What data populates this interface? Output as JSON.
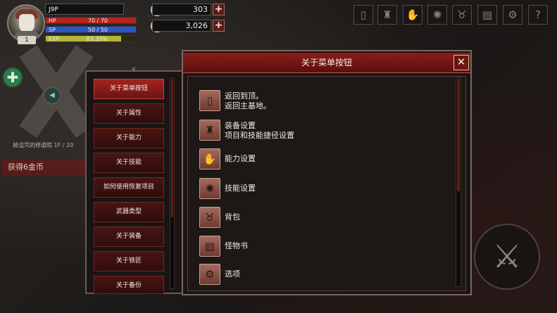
{
  "player": {
    "name": "J9P",
    "level": "1",
    "hp_label": "HP",
    "hp_value": "70 / 70",
    "hp_fraction": 1.0,
    "sp_label": "SP",
    "sp_value": "50 / 50",
    "sp_fraction": 1.0,
    "exp_label": "EXP",
    "exp_value": "83.33%",
    "exp_fraction": 0.8333
  },
  "currency": {
    "gems": "303",
    "gold": "3,026",
    "plus": "+"
  },
  "toolbar": {
    "icons": [
      "door-icon",
      "armor-icon",
      "ability-icon",
      "skill-icon",
      "bag-icon",
      "book-icon",
      "gear-icon",
      "help-icon"
    ],
    "help_glyph": "?",
    "gear_glyph": "⚙"
  },
  "hud": {
    "add_glyph": "✚",
    "nav_glyph": "◀",
    "location": "被诅咒的修道院 1F / 20",
    "toast": "获得6金币",
    "sword_glyph": "⚔"
  },
  "categories": {
    "items": [
      {
        "label": "关于菜单按钮",
        "active": true
      },
      {
        "label": "关于属性"
      },
      {
        "label": "关于能力"
      },
      {
        "label": "关于技能"
      },
      {
        "label": "如何使用恢复项目"
      },
      {
        "label": "武器类型"
      },
      {
        "label": "关于装备"
      },
      {
        "label": "关于铁匠"
      },
      {
        "label": "关于备份"
      }
    ]
  },
  "panel": {
    "title": "关于菜单按钮",
    "close": "✕",
    "rows": [
      {
        "icon": "door-icon",
        "glyph": "▯",
        "line1": "返回到顶。",
        "line2": "返回主基地。"
      },
      {
        "icon": "armor-icon",
        "glyph": "♜",
        "line1": "装备设置",
        "line2": "项目和技能捷径设置"
      },
      {
        "icon": "ability-icon",
        "glyph": "✋",
        "line1": "能力设置",
        "line2": ""
      },
      {
        "icon": "skill-icon",
        "glyph": "✺",
        "line1": "技能设置",
        "line2": ""
      },
      {
        "icon": "bag-icon",
        "glyph": "♉",
        "line1": "背包",
        "line2": ""
      },
      {
        "icon": "book-icon",
        "glyph": "▤",
        "line1": "怪物书",
        "line2": ""
      },
      {
        "icon": "gear-icon",
        "glyph": "⚙",
        "line1": "选项",
        "line2": ""
      }
    ]
  },
  "colors": {
    "hp": "#b3241f",
    "sp": "#2c55c8",
    "exp": "#b4b33a",
    "accent": "#a3231f"
  }
}
